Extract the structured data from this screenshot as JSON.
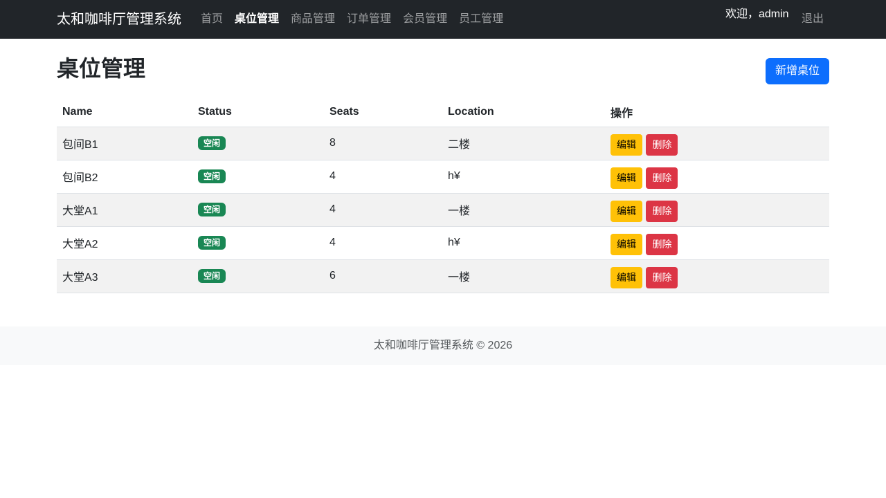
{
  "nav": {
    "brand": "太和咖啡厅管理系统",
    "links": [
      {
        "label": "首页",
        "active": false
      },
      {
        "label": "桌位管理",
        "active": true
      },
      {
        "label": "商品管理",
        "active": false
      },
      {
        "label": "订单管理",
        "active": false
      },
      {
        "label": "会员管理",
        "active": false
      },
      {
        "label": "员工管理",
        "active": false
      }
    ],
    "welcome": "欢迎，admin",
    "logout": "退出"
  },
  "page": {
    "title": "桌位管理",
    "add_button": "新增桌位"
  },
  "table": {
    "columns": [
      "Name",
      "Status",
      "Seats",
      "Location",
      "操作"
    ],
    "rows": [
      {
        "name": "包间B1",
        "status": "空闲",
        "seats": "8",
        "location": "二楼",
        "edit": "编辑",
        "delete": "删除"
      },
      {
        "name": "包间B2",
        "status": "空闲",
        "seats": "4",
        "location": "h¥",
        "edit": "编辑",
        "delete": "删除"
      },
      {
        "name": "大堂A1",
        "status": "空闲",
        "seats": "4",
        "location": "一楼",
        "edit": "编辑",
        "delete": "删除"
      },
      {
        "name": "大堂A2",
        "status": "空闲",
        "seats": "4",
        "location": "h¥",
        "edit": "编辑",
        "delete": "删除"
      },
      {
        "name": "大堂A3",
        "status": "空闲",
        "seats": "6",
        "location": "一楼",
        "edit": "编辑",
        "delete": "删除"
      }
    ]
  },
  "footer": {
    "text": "太和咖啡厅管理系统 © 2026"
  },
  "colors": {
    "navbar": "#212529",
    "primary": "#0d6efd",
    "success": "#198754",
    "warning": "#ffc107",
    "danger": "#dc3545"
  }
}
